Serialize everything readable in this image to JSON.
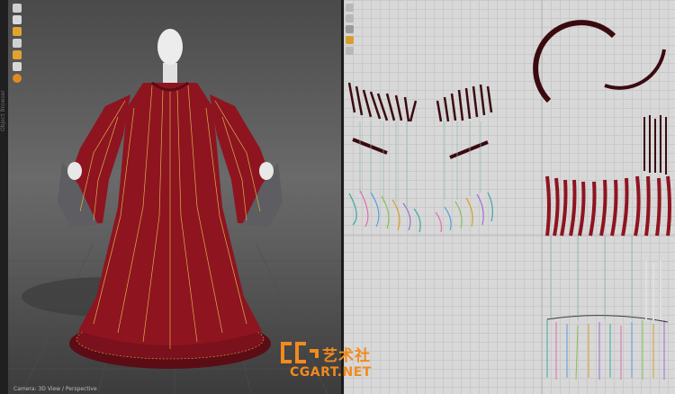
{
  "left_rail": {
    "label": "Object Browser"
  },
  "viewport_3d": {
    "toolbar": [
      {
        "icon": "sphere-icon",
        "color": "#cfcfcf"
      },
      {
        "icon": "avatar-icon",
        "color": "#d9d9d9"
      },
      {
        "icon": "simulate-icon",
        "color": "#e0a230"
      },
      {
        "icon": "pin-icon",
        "color": "#d0d0d0"
      },
      {
        "icon": "trace-icon",
        "color": "#e0a230"
      },
      {
        "icon": "brush-icon",
        "color": "#d8d8d8"
      },
      {
        "icon": "record-icon",
        "color": "#e08a20"
      }
    ],
    "status": "Camera: 3D View / Perspective",
    "colors": {
      "garment": "#8e1420",
      "garment_dark": "#5c0c14",
      "seam": "#d9b24a",
      "avatar": "#e8e8e8"
    }
  },
  "pattern_2d": {
    "toolbar": [
      {
        "icon": "select-arrow-icon"
      },
      {
        "icon": "point-icon"
      },
      {
        "icon": "seam-icon"
      },
      {
        "icon": "sewing-icon"
      },
      {
        "icon": "segment-icon"
      }
    ],
    "colors": {
      "background": "#d8d8d8",
      "pattern": "#8e1420",
      "pattern_outline": "#3a0a10"
    }
  },
  "watermark": {
    "cn": "艺术社",
    "en": "CGART.NET",
    "color": "#f28a1e"
  }
}
